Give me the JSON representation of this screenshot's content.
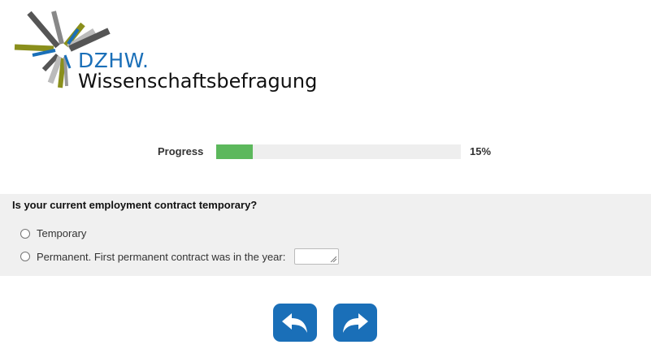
{
  "header": {
    "brand": "DZHW.",
    "subbrand": "Wissenschaftsbefragung",
    "logo_icon": "dzhw-burst-logo"
  },
  "progress": {
    "label": "Progress",
    "value_text": "15%",
    "fraction": 0.15,
    "fill_color": "#5cb85c"
  },
  "question": {
    "text": "Is your current employment contract temporary?",
    "options": [
      {
        "label": "Temporary",
        "selected": false
      },
      {
        "label": "Permanent. First permanent contract was in the year:",
        "selected": false
      }
    ],
    "year_input_value": ""
  },
  "navigation": {
    "back_icon": "undo-arrow-icon",
    "next_icon": "redo-arrow-icon",
    "button_color": "#1a6fb8"
  }
}
